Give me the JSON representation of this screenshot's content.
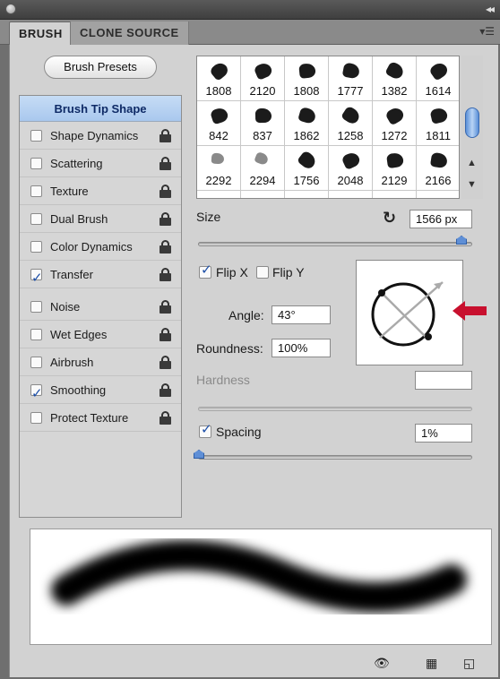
{
  "tabs": [
    {
      "label": "BRUSH",
      "active": true
    },
    {
      "label": "CLONE SOURCE",
      "active": false
    }
  ],
  "presets_button": "Brush Presets",
  "brush_tip_shape": "Brush Tip Shape",
  "options": [
    {
      "label": "Shape Dynamics",
      "checked": false
    },
    {
      "label": "Scattering",
      "checked": false
    },
    {
      "label": "Texture",
      "checked": false
    },
    {
      "label": "Dual Brush",
      "checked": false
    },
    {
      "label": "Color Dynamics",
      "checked": false
    },
    {
      "label": "Transfer",
      "checked": true
    },
    {
      "label": "Noise",
      "checked": false
    },
    {
      "label": "Wet Edges",
      "checked": false
    },
    {
      "label": "Airbrush",
      "checked": false
    },
    {
      "label": "Smoothing",
      "checked": true
    },
    {
      "label": "Protect Texture",
      "checked": false
    }
  ],
  "brushes": [
    "1808",
    "2120",
    "1808",
    "1777",
    "1382",
    "1614",
    "842",
    "837",
    "1862",
    "1258",
    "1272",
    "1811",
    "2292",
    "2294",
    "1756",
    "2048",
    "2129",
    "2166"
  ],
  "size": {
    "label": "Size",
    "value": "1566 px"
  },
  "flip_x": {
    "label": "Flip X",
    "checked": true
  },
  "flip_y": {
    "label": "Flip Y",
    "checked": false
  },
  "angle": {
    "label": "Angle:",
    "value": "43°"
  },
  "roundness": {
    "label": "Roundness:",
    "value": "100%"
  },
  "hardness": {
    "label": "Hardness",
    "value": ""
  },
  "spacing": {
    "label": "Spacing",
    "checked": true,
    "value": "1%"
  },
  "colors": {
    "accent": "#1d4fa8",
    "selected_row": "#b8d2f2",
    "arrow": "#c8102e"
  }
}
